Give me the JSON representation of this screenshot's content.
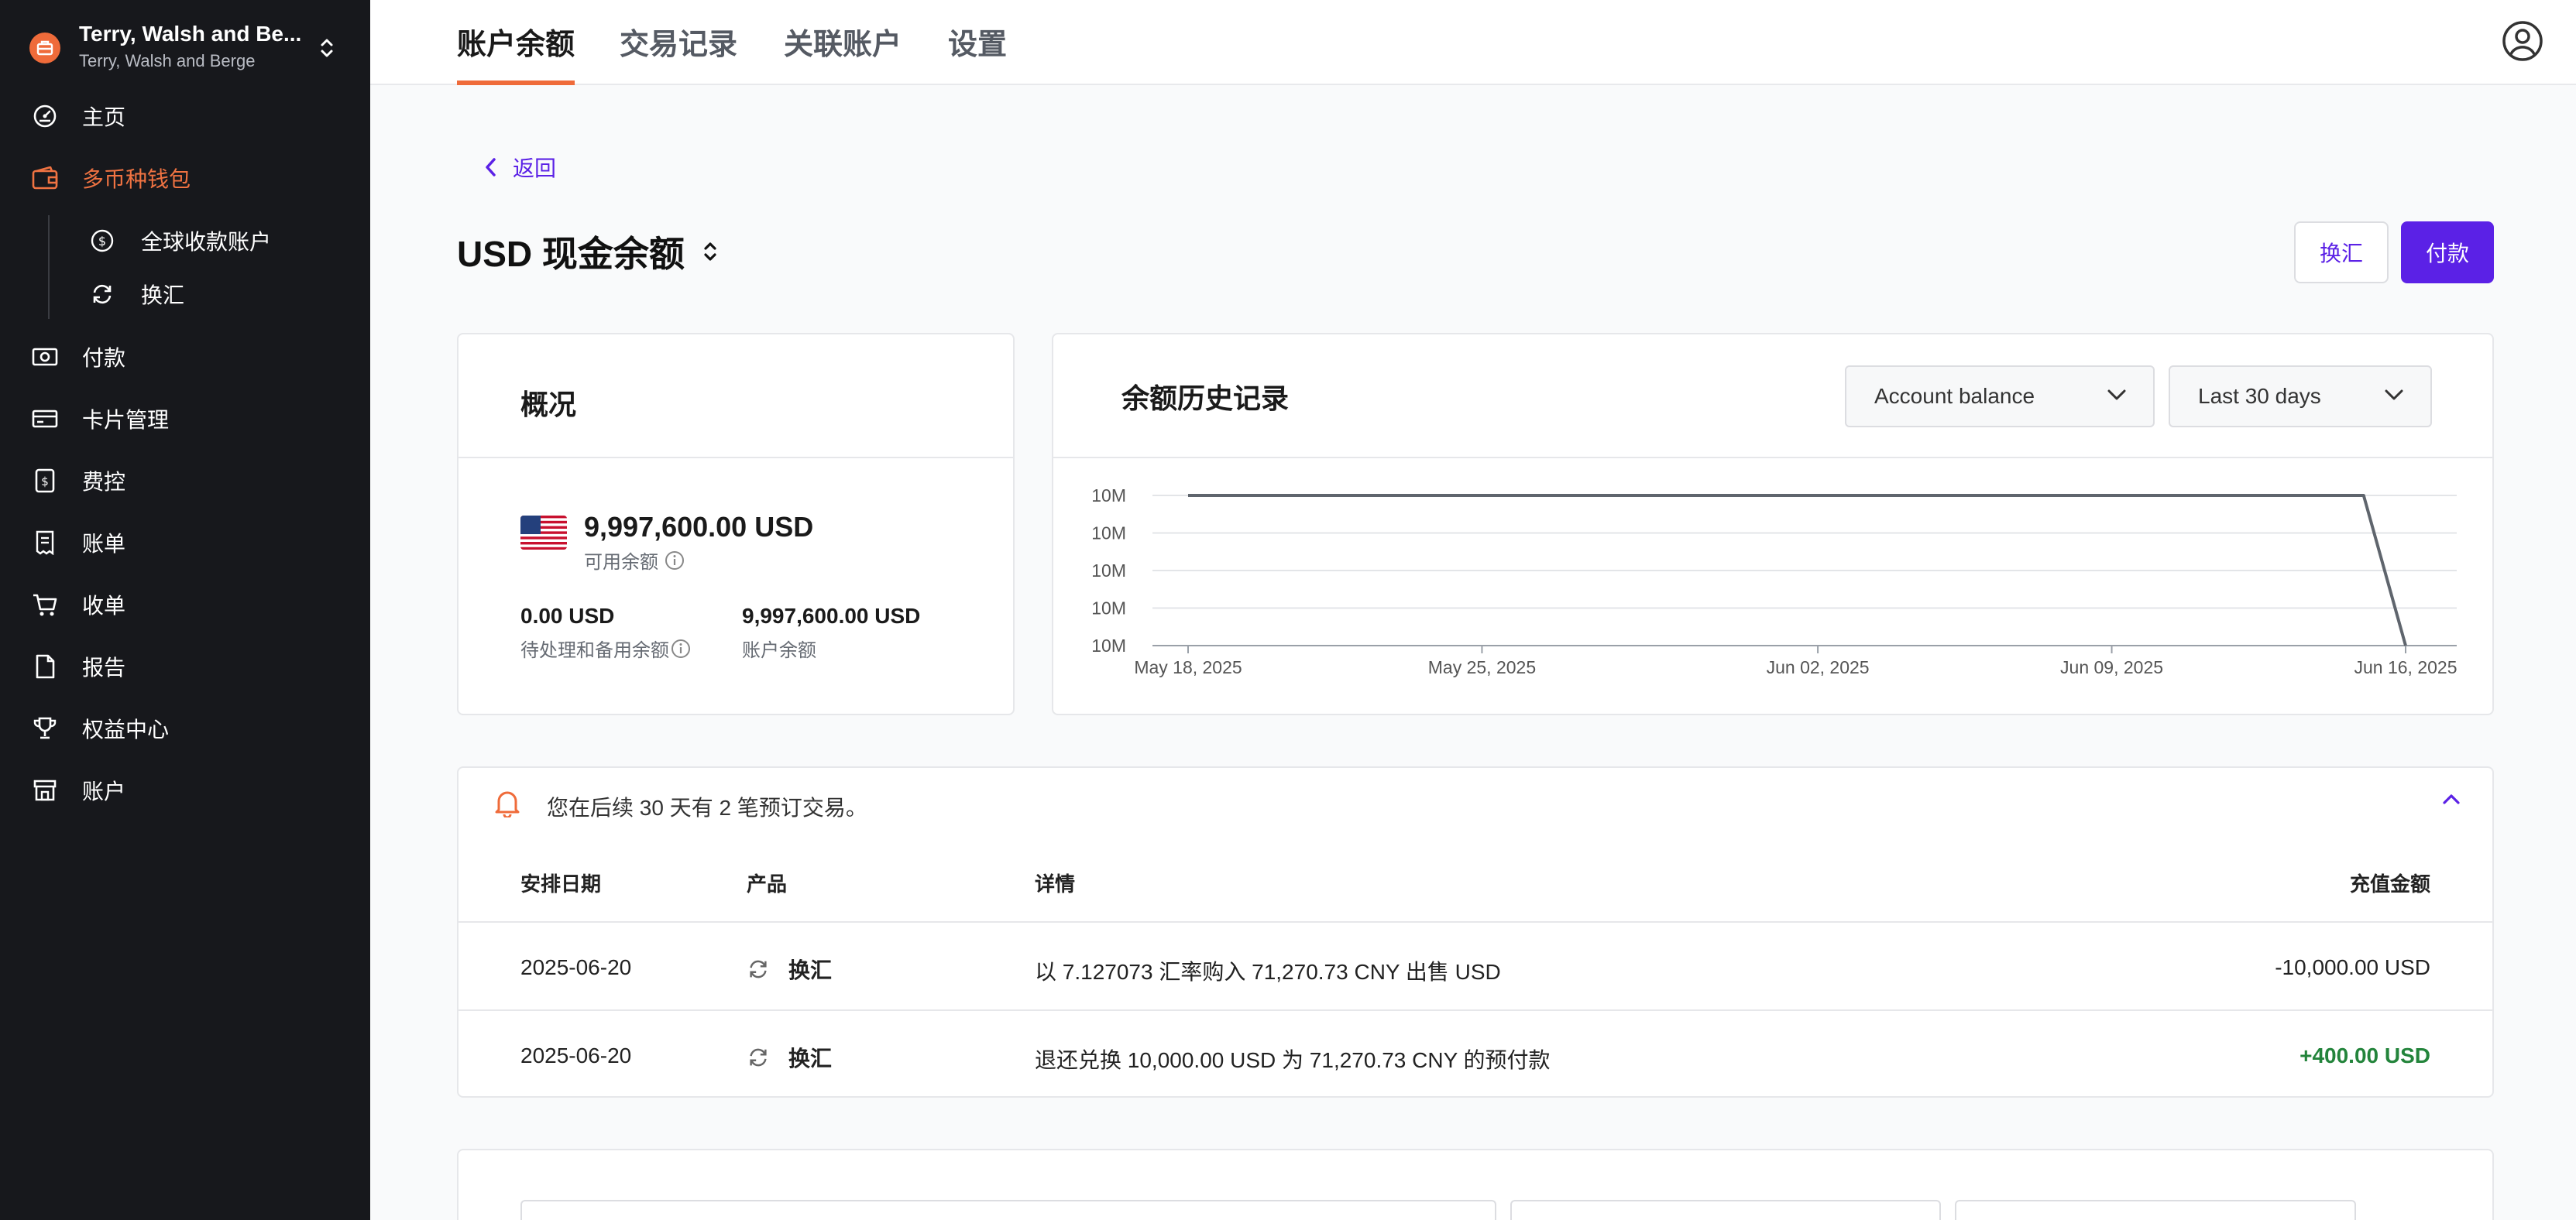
{
  "sidebar": {
    "org_name": "Terry, Walsh and Be...",
    "org_sub": "Terry, Walsh and Berge",
    "items": [
      {
        "label": "主页",
        "icon": "dashboard-icon"
      },
      {
        "label": "多币种钱包",
        "icon": "wallet-icon",
        "active": true
      },
      {
        "label": "全球收款账户",
        "icon": "dollar-circle-icon"
      },
      {
        "label": "换汇",
        "icon": "refresh-icon"
      },
      {
        "label": "付款",
        "icon": "payment-icon"
      },
      {
        "label": "卡片管理",
        "icon": "card-icon"
      },
      {
        "label": "费控",
        "icon": "expense-icon"
      },
      {
        "label": "账单",
        "icon": "bill-icon"
      },
      {
        "label": "收单",
        "icon": "cart-icon"
      },
      {
        "label": "报告",
        "icon": "report-icon"
      },
      {
        "label": "权益中心",
        "icon": "trophy-icon"
      },
      {
        "label": "账户",
        "icon": "store-icon"
      }
    ]
  },
  "tabs": [
    "账户余额",
    "交易记录",
    "关联账户",
    "设置"
  ],
  "active_tab": "账户余额",
  "back_label": "返回",
  "page_title": "USD 现金余额",
  "actions": {
    "convert": "换汇",
    "pay": "付款"
  },
  "overview": {
    "title": "概况",
    "available_amount": "9,997,600.00 USD",
    "available_label": "可用余额",
    "pending_amount": "0.00 USD",
    "pending_label": "待处理和备用余额",
    "account_amount": "9,997,600.00 USD",
    "account_label": "账户余额"
  },
  "history": {
    "title": "余额历史记录",
    "metric_select": "Account balance",
    "range_select": "Last 30 days"
  },
  "chart_data": {
    "type": "line",
    "title": "余额历史记录",
    "y_tick_labels": [
      "10M",
      "10M",
      "10M",
      "10M",
      "10M"
    ],
    "x_tick_labels": [
      "May 18, 2025",
      "May 25, 2025",
      "Jun 02, 2025",
      "Jun 09, 2025",
      "Jun 16, 2025"
    ],
    "x": [
      "2025-05-18",
      "2025-06-15",
      "2025-06-16"
    ],
    "y": [
      10000000,
      10000000,
      9997600
    ],
    "grid": true,
    "line_color": "#5f656d"
  },
  "scheduled": {
    "notice": "您在后续 30 天有 2 笔预订交易。",
    "columns": [
      "安排日期",
      "产品",
      "详情",
      "充值金额"
    ],
    "rows": [
      {
        "date": "2025-06-20",
        "product": "换汇",
        "details": "以 7.127073 汇率购入 71,270.73 CNY 出售 USD",
        "amount": "-10,000.00 USD",
        "positive": false
      },
      {
        "date": "2025-06-20",
        "product": "换汇",
        "details": "退还兑换 10,000.00 USD 为 71,270.73 CNY 的预付款",
        "amount": "+400.00 USD",
        "positive": true
      }
    ]
  },
  "colors": {
    "accent": "#5b21e6",
    "brand": "#ef6b3a",
    "sidebar": "#17181c",
    "positive": "#23843b"
  }
}
